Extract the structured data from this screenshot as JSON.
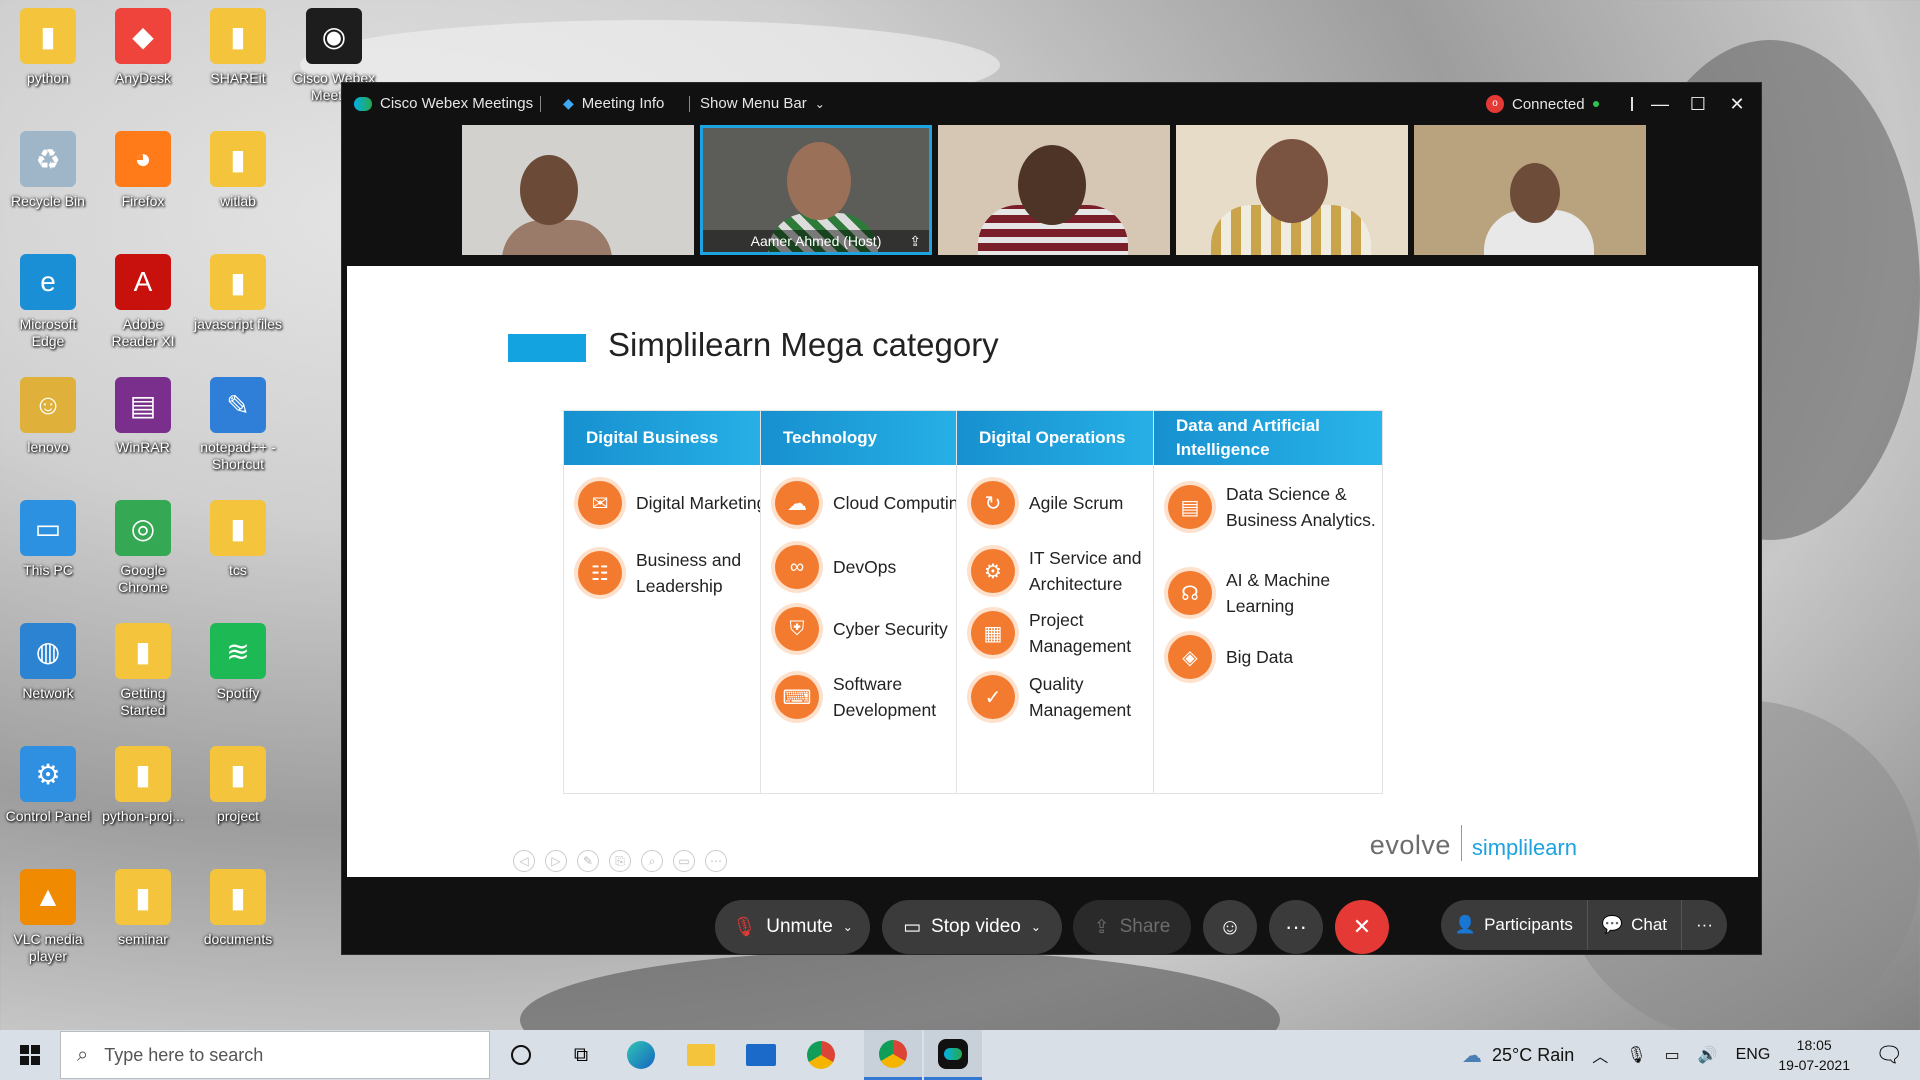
{
  "desktop": {
    "icons": [
      {
        "label": "python",
        "icon": "folder-icon"
      },
      {
        "label": "AnyDesk",
        "icon": "anydesk-icon"
      },
      {
        "label": "SHAREit",
        "icon": "folder-icon"
      },
      {
        "label": "Cisco Webex Meeti...",
        "icon": "webex-icon"
      },
      {
        "label": "Recycle Bin",
        "icon": "recycle-bin-icon"
      },
      {
        "label": "Firefox",
        "icon": "firefox-icon"
      },
      {
        "label": "witlab",
        "icon": "folder-icon"
      },
      {
        "label": "Microsoft Edge",
        "icon": "edge-icon"
      },
      {
        "label": "Adobe Reader XI",
        "icon": "adobe-reader-icon"
      },
      {
        "label": "javascript files",
        "icon": "folder-icon"
      },
      {
        "label": "lenovo",
        "icon": "user-folder-icon"
      },
      {
        "label": "WinRAR",
        "icon": "winrar-icon"
      },
      {
        "label": "notepad++ - Shortcut",
        "icon": "notepad-icon"
      },
      {
        "label": "This PC",
        "icon": "computer-icon"
      },
      {
        "label": "Google Chrome",
        "icon": "chrome-icon"
      },
      {
        "label": "tcs",
        "icon": "folder-icon"
      },
      {
        "label": "Network",
        "icon": "network-icon"
      },
      {
        "label": "Getting Started",
        "icon": "folder-icon"
      },
      {
        "label": "Spotify",
        "icon": "spotify-icon"
      },
      {
        "label": "Control Panel",
        "icon": "control-panel-icon"
      },
      {
        "label": "python-proj...",
        "icon": "folder-icon"
      },
      {
        "label": "project",
        "icon": "folder-icon"
      },
      {
        "label": "VLC media player",
        "icon": "vlc-icon"
      },
      {
        "label": "seminar",
        "icon": "folder-icon"
      },
      {
        "label": "documents",
        "icon": "folder-icon"
      }
    ]
  },
  "webex": {
    "app_name": "Cisco Webex Meetings",
    "meeting_info": "Meeting Info",
    "show_menu_bar": "Show Menu Bar",
    "status": "Connected",
    "host_tile_name": "Aamer Ahmed  (Host)",
    "slide": {
      "title": "Simplilearn Mega category",
      "columns": [
        {
          "header": "Digital Business",
          "items": [
            "Digital Marketing",
            "Business and Leadership"
          ]
        },
        {
          "header": "Technology",
          "items": [
            "Cloud Computing",
            "DevOps",
            "Cyber Security",
            "Software Development"
          ]
        },
        {
          "header": "Digital Operations",
          "items": [
            "Agile Scrum",
            "IT Service and Architecture",
            "Project Management",
            "Quality Management"
          ]
        },
        {
          "header": "Data and Artificial Intelligence",
          "items": [
            "Data Science & Business Analytics.",
            "AI & Machine Learning",
            "Big Data"
          ]
        }
      ],
      "brand_left": "evolve",
      "brand_right": "simplilearn"
    },
    "controls": {
      "unmute": "Unmute",
      "stop_video": "Stop video",
      "share": "Share",
      "participants": "Participants",
      "chat": "Chat"
    }
  },
  "taskbar": {
    "search_placeholder": "Type here to search",
    "weather": "25°C  Rain",
    "language": "ENG",
    "time": "18:05",
    "date": "19-07-2021"
  },
  "colors": {
    "accent": "#13a3e0",
    "orange": "#f37b2f",
    "end_call": "#e53935"
  }
}
